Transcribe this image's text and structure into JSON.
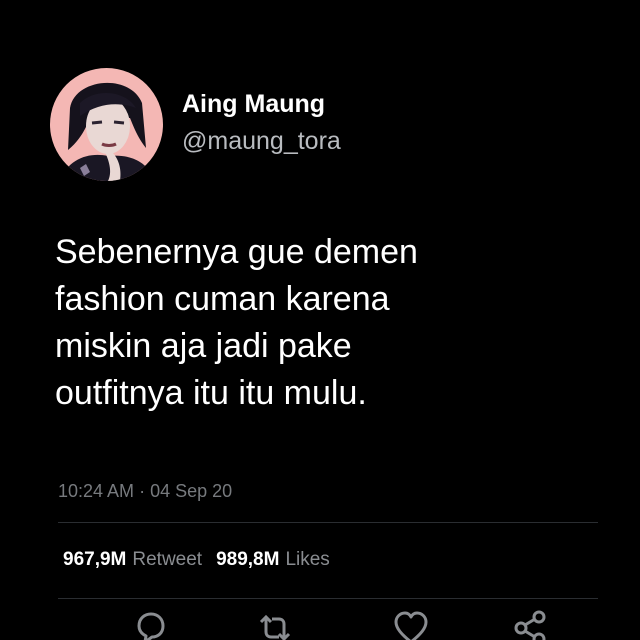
{
  "user": {
    "display_name": "Aing Maung",
    "handle": "@maung_tora",
    "avatar_icon": "profile-photo"
  },
  "tweet": {
    "lines": [
      "Sebenernya gue demen",
      "fashion cuman karena",
      "miskin aja jadi pake",
      "outfitnya itu itu mulu."
    ],
    "time": "10:24 AM",
    "separator": "·",
    "date": "04 Sep 20"
  },
  "stats": {
    "retweets_count": "967,9M",
    "retweets_label": "Retweet",
    "likes_count": "989,8M",
    "likes_label": "Likes"
  },
  "actions": [
    {
      "icon": "reply-icon"
    },
    {
      "icon": "retweet-icon"
    },
    {
      "icon": "like-icon"
    },
    {
      "icon": "share-icon"
    }
  ],
  "colors": {
    "background": "#000000",
    "primary_text": "#ffffff",
    "secondary_text": "#777a7e",
    "avatar_background": "#f4b7b4"
  }
}
